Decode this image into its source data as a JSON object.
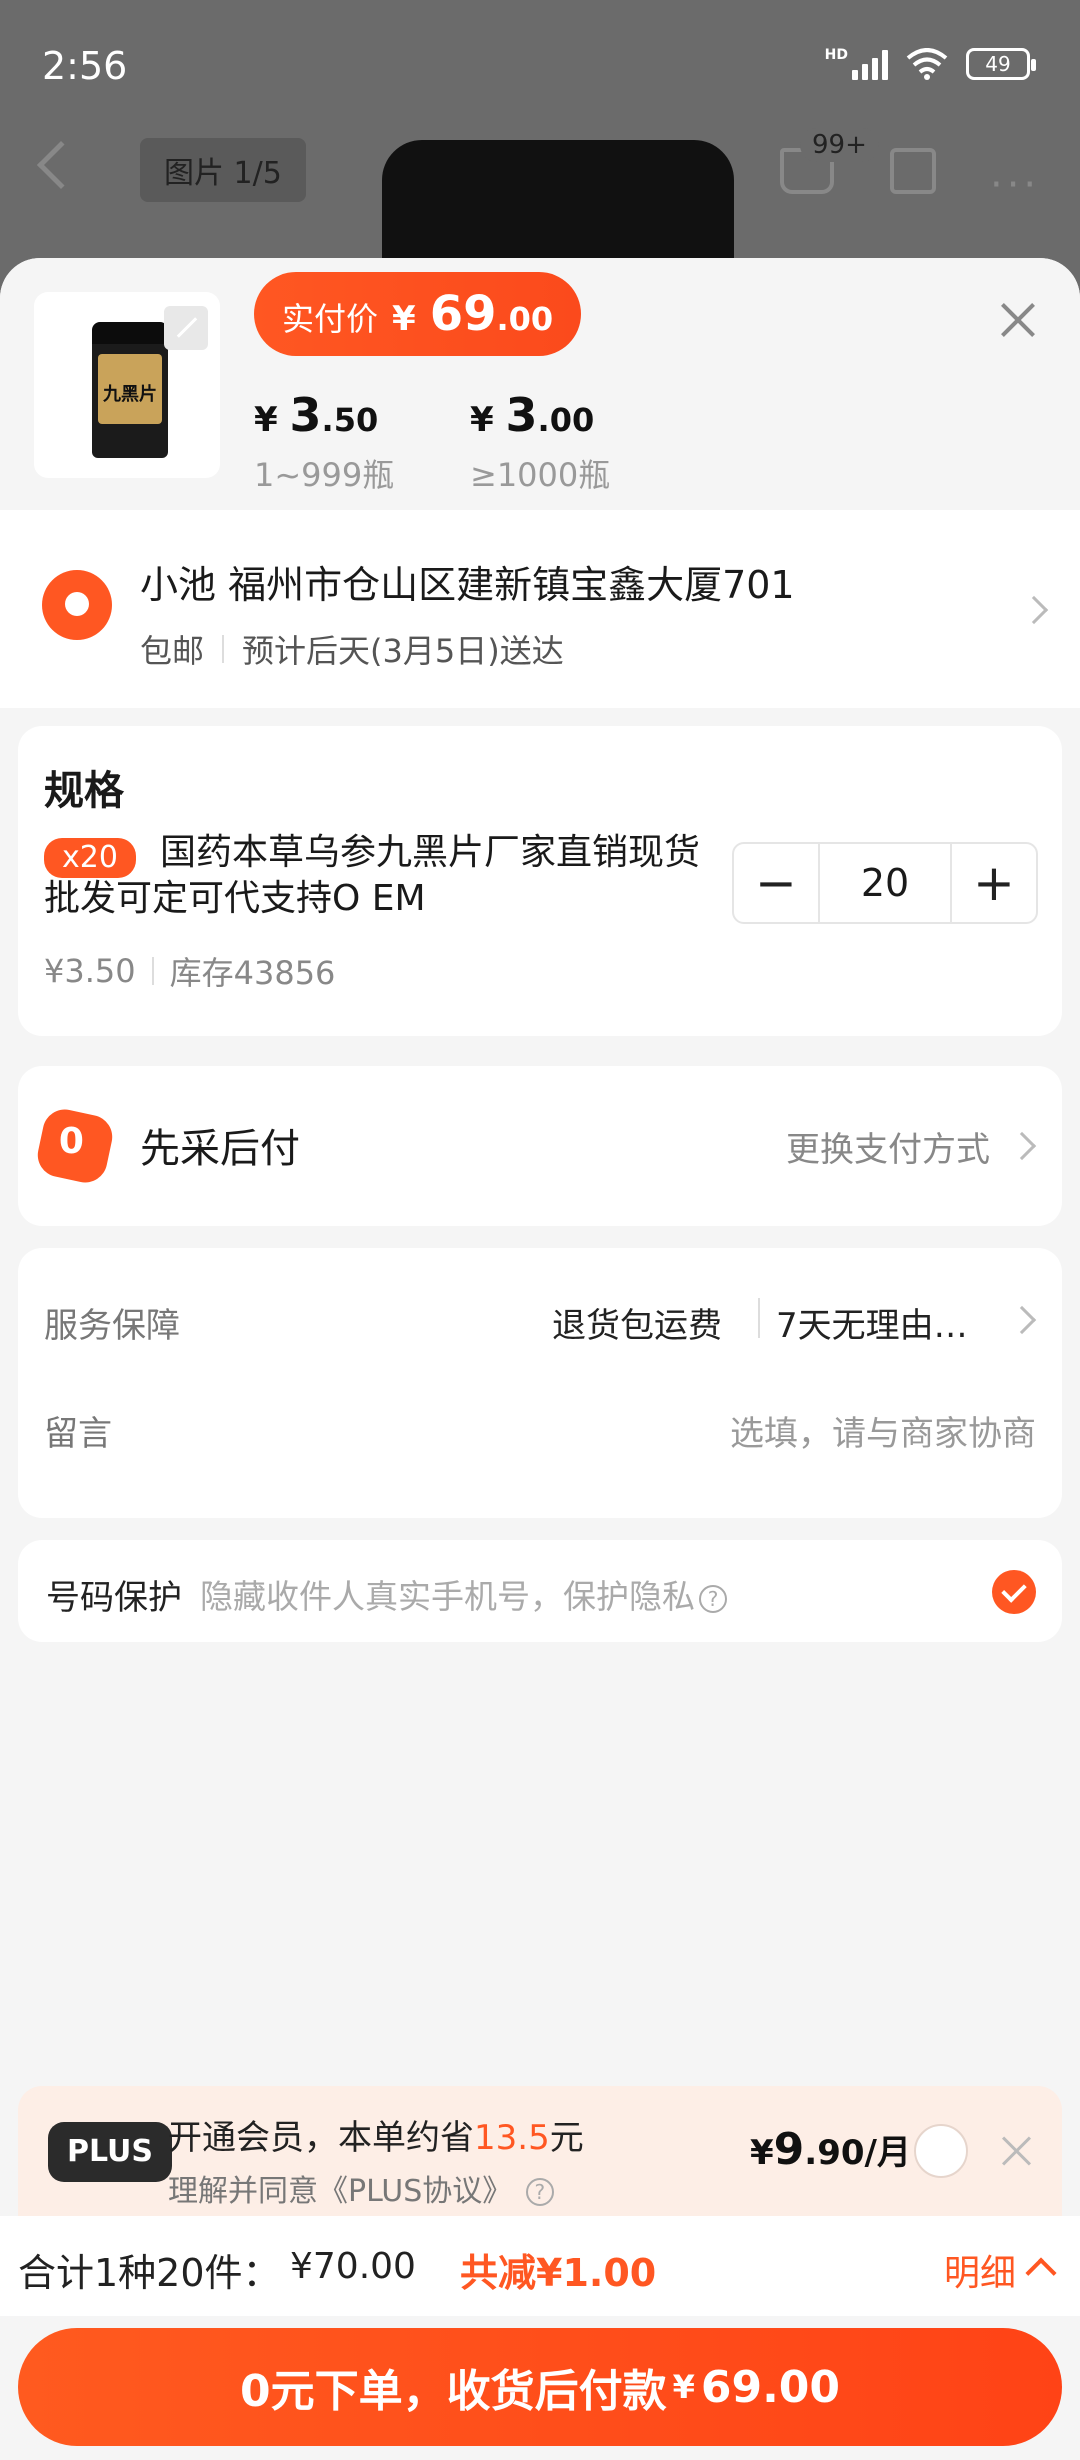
{
  "status_bar": {
    "time": "2:56",
    "network": "HD",
    "battery": "49"
  },
  "nav": {
    "image_counter": "图片 1/5",
    "cart_badge": "99+"
  },
  "product": {
    "thumb_label": "九黑片",
    "actual_price_label": "实付价",
    "actual_price_currency": "¥",
    "actual_price_int": "69",
    "actual_price_dec": ".00",
    "tiers": [
      {
        "currency": "¥",
        "int": "3",
        "dec": ".50",
        "qty": "1~999瓶"
      },
      {
        "currency": "¥",
        "int": "3",
        "dec": ".00",
        "qty": "≥1000瓶"
      }
    ]
  },
  "address": {
    "line1": "小池 福州市仓山区建新镇宝鑫大厦701",
    "shipping": "包邮",
    "delivery": "预计后天(3月5日)送达"
  },
  "spec": {
    "title": "规格",
    "qty_tag": "x20",
    "name": "国药本草乌参九黑片厂家直销现货批发可定可代支持O EM",
    "unit_price": "¥3.50",
    "stock": "库存43856",
    "quantity": "20",
    "minus": "−",
    "plus": "+"
  },
  "payment": {
    "icon_text": "0",
    "title": "先采后付",
    "switch_label": "更换支付方式"
  },
  "service": {
    "label": "服务保障",
    "value1": "退货包运费",
    "value2": "7天无理由…",
    "message_label": "留言",
    "message_placeholder": "选填，请与商家协商"
  },
  "privacy": {
    "label": "号码保护",
    "desc": "隐藏收件人真实手机号，保护隐私",
    "help": "?"
  },
  "plus": {
    "logo": "PLUS",
    "line1_prefix": "开通会员，本单约省",
    "line1_amount": "13.5",
    "line1_suffix": "元",
    "line2": "理解并同意《PLUS协议》",
    "help": "?",
    "price_currency": "¥",
    "price_int": "9",
    "price_dec": ".90/月"
  },
  "summary": {
    "total_label": "合计1种20件：",
    "total_amount": "¥70.00",
    "discount": "共减¥1.00",
    "detail": "明细"
  },
  "cta": {
    "label": "0元下单，收货后付款",
    "currency": "¥",
    "amount": "69.00"
  },
  "colors": {
    "accent": "#ff5722",
    "background": "#f5f5f5"
  }
}
